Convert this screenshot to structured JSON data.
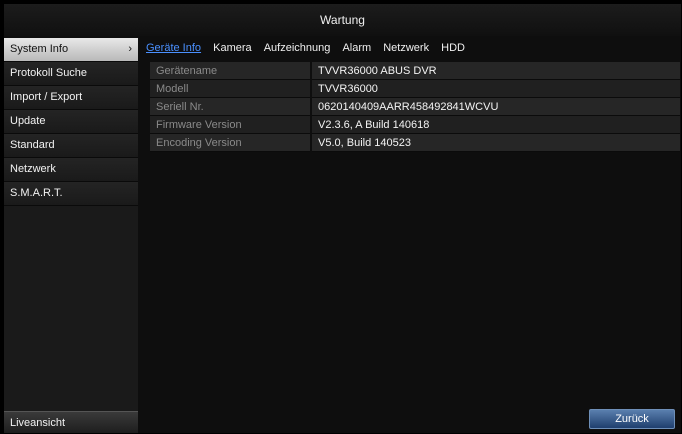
{
  "window": {
    "title": "Wartung"
  },
  "sidebar": {
    "items": [
      {
        "label": "System Info",
        "chevron": "›"
      },
      {
        "label": "Protokoll Suche"
      },
      {
        "label": "Import / Export"
      },
      {
        "label": "Update"
      },
      {
        "label": "Standard"
      },
      {
        "label": "Netzwerk"
      },
      {
        "label": "S.M.A.R.T."
      }
    ],
    "live_label": "Liveansicht"
  },
  "tabs": [
    {
      "label": "Geräte Info"
    },
    {
      "label": "Kamera"
    },
    {
      "label": "Aufzeichnung"
    },
    {
      "label": "Alarm"
    },
    {
      "label": "Netzwerk"
    },
    {
      "label": "HDD"
    }
  ],
  "device_info": {
    "rows": [
      {
        "key": "Gerätename",
        "value": "TVVR36000 ABUS DVR"
      },
      {
        "key": "Modell",
        "value": "TVVR36000"
      },
      {
        "key": "Seriell Nr.",
        "value": "0620140409AARR458492841WCVU"
      },
      {
        "key": "Firmware Version",
        "value": "V2.3.6, A Build 140618"
      },
      {
        "key": "Encoding Version",
        "value": "V5.0, Build 140523"
      }
    ]
  },
  "footer": {
    "back_label": "Zurück"
  },
  "colors": {
    "active_tab": "#4a90ff",
    "button_blue": "#3a5f90",
    "active_sidebar": "#d0d0d0"
  }
}
